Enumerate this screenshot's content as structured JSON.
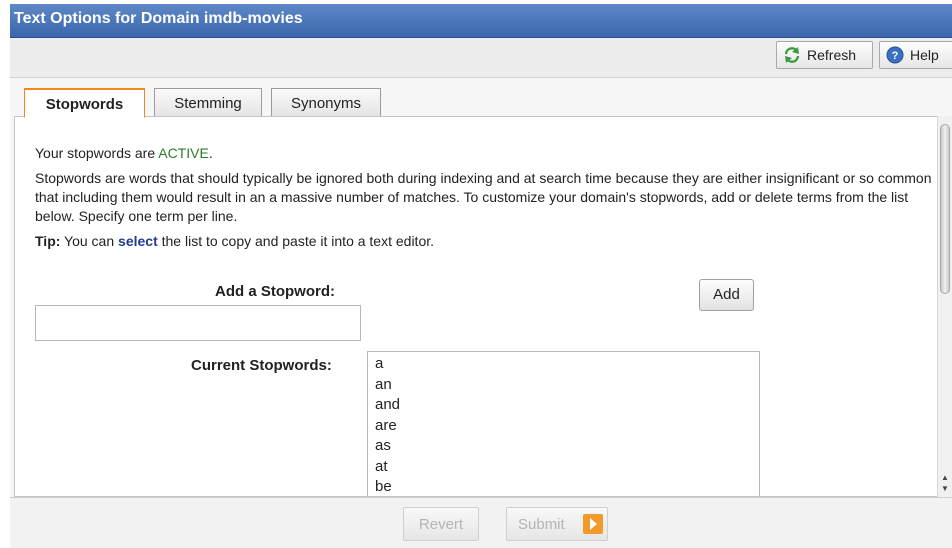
{
  "window": {
    "title": "Text Options for Domain imdb-movies"
  },
  "toolbar": {
    "refresh_label": "Refresh",
    "help_label": "Help"
  },
  "tabs": [
    {
      "label": "Stopwords",
      "active": true
    },
    {
      "label": "Stemming",
      "active": false
    },
    {
      "label": "Synonyms",
      "active": false
    }
  ],
  "status": {
    "prefix": "Your stopwords are ",
    "state": "ACTIVE",
    "suffix": "."
  },
  "description": "Stopwords are words that should typically be ignored both during indexing and at search time because they are either insignificant or so common that including them would result in an a massive number of matches. To customize your domain's stopwords, add or delete terms from the list below. Specify one term per line.",
  "tip": {
    "label": "Tip:",
    "before": " You can ",
    "link": "select",
    "after": " the list to copy and paste it into a text editor."
  },
  "add_form": {
    "label": "Add a Stopword:",
    "value": "",
    "button": "Add"
  },
  "current": {
    "label": "Current Stopwords:",
    "words": [
      "a",
      "an",
      "and",
      "are",
      "as",
      "at",
      "be"
    ]
  },
  "footer": {
    "revert_label": "Revert",
    "submit_label": "Submit"
  },
  "colors": {
    "title_bar": "#3a66ad",
    "active_tab_border": "#f08a1f",
    "active_status": "#2c7a2c",
    "submit_icon": "#f29a2a"
  }
}
